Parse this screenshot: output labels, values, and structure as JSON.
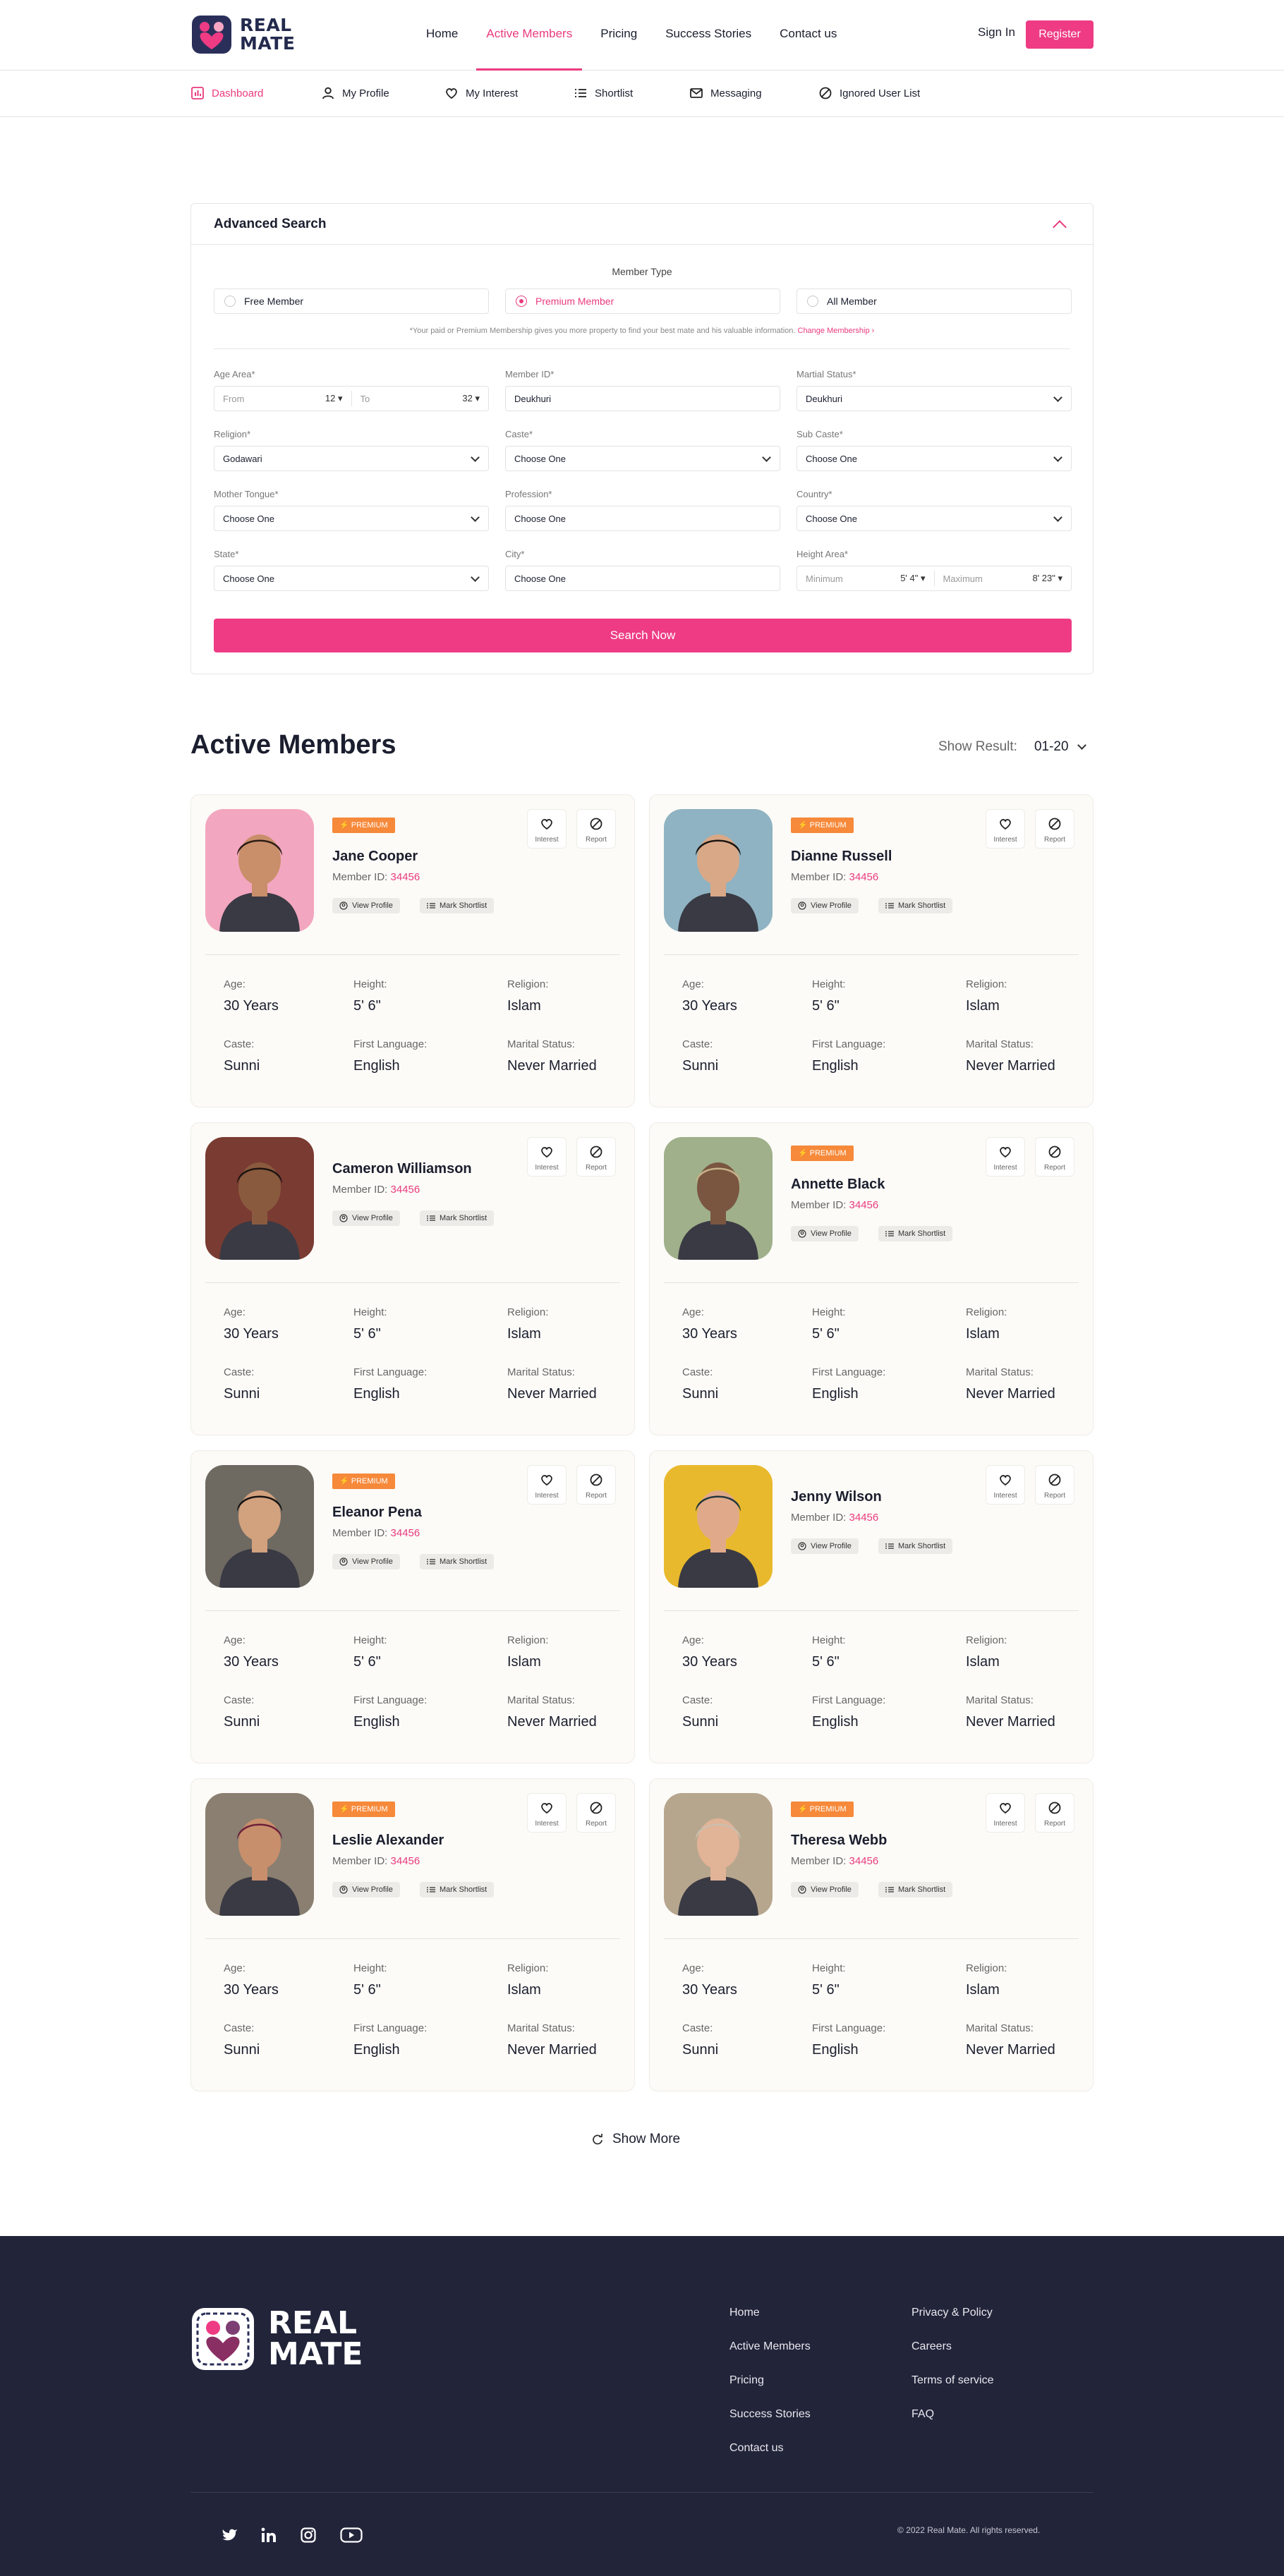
{
  "brand": {
    "line1": "REAL",
    "line2": "MATE",
    "color": "#ea3a7e",
    "navy": "#232a4d"
  },
  "nav": {
    "items": [
      "Home",
      "Active Members",
      "Pricing",
      "Success Stories",
      "Contact us"
    ],
    "active": "Active Members",
    "signin": "Sign In",
    "register": "Register"
  },
  "subnav": [
    {
      "label": "Dashboard",
      "icon": "dashboard-icon"
    },
    {
      "label": "My Profile",
      "icon": "user-icon"
    },
    {
      "label": "My Interest",
      "icon": "heart-icon"
    },
    {
      "label": "Shortlist",
      "icon": "list-icon"
    },
    {
      "label": "Messaging",
      "icon": "mail-icon"
    },
    {
      "label": "Ignored User List",
      "icon": "block-icon"
    }
  ],
  "search": {
    "title": "Advanced Search",
    "member_type_label": "Member Type",
    "member_types": [
      "Free Member",
      "Premium Member",
      "All Member"
    ],
    "selected_type": "Premium Member",
    "note": "*Your paid or Premium Membership gives you more property to find your best mate and his valuable information.",
    "note_link": "Change Membership",
    "fields": {
      "age": {
        "label": "Age Area*",
        "from": "From",
        "from_val": "12",
        "to": "To",
        "to_val": "32"
      },
      "member_id": {
        "label": "Member ID*",
        "value": "Deukhuri"
      },
      "marital": {
        "label": "Martial Status*",
        "value": "Deukhuri"
      },
      "religion": {
        "label": "Religion*",
        "value": "Godawari"
      },
      "caste": {
        "label": "Caste*",
        "value": "Choose One"
      },
      "subcaste": {
        "label": "Sub Caste*",
        "value": "Choose One"
      },
      "mother_tongue": {
        "label": "Mother Tongue*",
        "value": "Choose One"
      },
      "profession": {
        "label": "Profession*",
        "value": "Choose One"
      },
      "country": {
        "label": "Country*",
        "value": "Choose One"
      },
      "state": {
        "label": "State*",
        "value": "Choose One"
      },
      "city": {
        "label": "City*",
        "value": "Choose One"
      },
      "height": {
        "label": "Height Area*",
        "min": "Minimum",
        "min_val": "5' 4\"",
        "max": "Maximum",
        "max_val": "8' 23\""
      }
    },
    "button": "Search Now"
  },
  "members": {
    "title": "Active Members",
    "show_result_label": "Show Result:",
    "show_result_value": "01-20",
    "labels": {
      "premium": "PREMIUM",
      "member_id": "Member ID:",
      "view": "View Profile",
      "shortlist": "Mark Shortlist",
      "interest": "Interest",
      "report": "Report",
      "age": "Age:",
      "height": "Height:",
      "religion": "Religion:",
      "caste": "Caste:",
      "language": "First Language:",
      "marital": "Marital Status:"
    },
    "list": [
      {
        "name": "Jane Cooper",
        "id": "34456",
        "premium": true,
        "age": "30 Years",
        "height": "5' 6\"",
        "religion": "Islam",
        "caste": "Sunni",
        "language": "English",
        "marital": "Never Married",
        "photo_bg": "#f3a6bf",
        "skin": "#c98e6a",
        "hair": "#2b1d16"
      },
      {
        "name": "Dianne Russell",
        "id": "34456",
        "premium": true,
        "age": "30 Years",
        "height": "5' 6\"",
        "religion": "Islam",
        "caste": "Sunni",
        "language": "English",
        "marital": "Never Married",
        "photo_bg": "#8fb3c2",
        "skin": "#d9a887",
        "hair": "#1b1512"
      },
      {
        "name": "Cameron Williamson",
        "id": "34456",
        "premium": false,
        "age": "30 Years",
        "height": "5' 6\"",
        "religion": "Islam",
        "caste": "Sunni",
        "language": "English",
        "marital": "Never Married",
        "photo_bg": "#7a3b32",
        "skin": "#8a5a3e",
        "hair": "#1d1411"
      },
      {
        "name": "Annette Black",
        "id": "34456",
        "premium": true,
        "age": "30 Years",
        "height": "5' 6\"",
        "religion": "Islam",
        "caste": "Sunni",
        "language": "English",
        "marital": "Never Married",
        "photo_bg": "#9fb08a",
        "skin": "#7a5640",
        "hair": "#c8b28a"
      },
      {
        "name": "Eleanor Pena",
        "id": "34456",
        "premium": true,
        "age": "30 Years",
        "height": "5' 6\"",
        "religion": "Islam",
        "caste": "Sunni",
        "language": "English",
        "marital": "Never Married",
        "photo_bg": "#6e6a62",
        "skin": "#d2a17e",
        "hair": "#161211"
      },
      {
        "name": "Jenny Wilson",
        "id": "34456",
        "premium": false,
        "age": "30 Years",
        "height": "5' 6\"",
        "religion": "Islam",
        "caste": "Sunni",
        "language": "English",
        "marital": "Never Married",
        "photo_bg": "#e9b92d",
        "skin": "#e0a98a",
        "hair": "#23373f"
      },
      {
        "name": "Leslie Alexander",
        "id": "34456",
        "premium": true,
        "age": "30 Years",
        "height": "5' 6\"",
        "religion": "Islam",
        "caste": "Sunni",
        "language": "English",
        "marital": "Never Married",
        "photo_bg": "#8a7f70",
        "skin": "#c88f6c",
        "hair": "#6e1f3a"
      },
      {
        "name": "Theresa Webb",
        "id": "34456",
        "premium": true,
        "age": "30 Years",
        "height": "5' 6\"",
        "religion": "Islam",
        "caste": "Sunni",
        "language": "English",
        "marital": "Never Married",
        "photo_bg": "#b7a68e",
        "skin": "#e1b397",
        "hair": "#cbbfae"
      }
    ],
    "show_more": "Show More"
  },
  "footer": {
    "col1": [
      "Home",
      "Active Members",
      "Pricing",
      "Success Stories",
      "Contact us"
    ],
    "col2": [
      "Privacy & Policy",
      "Careers",
      "Terms of service",
      "FAQ"
    ],
    "social": [
      "twitter-icon",
      "linkedin-icon",
      "instagram-icon",
      "youtube-icon"
    ],
    "copyright": "© 2022 Real Mate. All rights reserved."
  }
}
